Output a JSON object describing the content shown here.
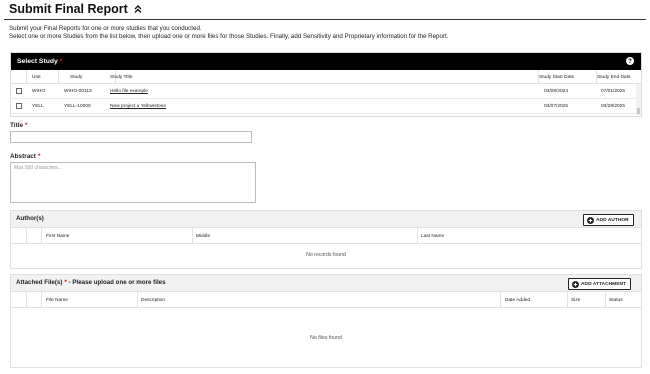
{
  "page": {
    "title": "Submit Final Report",
    "intro_line1": "Submit your Final Reports for one or more studies that you conducted.",
    "intro_line2": "Select one or more Studies from the list below, then upload one or more files for those Studies. Finally, add Sensitivity and Proprietary information for the Report."
  },
  "select_study": {
    "title": "Select Study",
    "required_mark": "*",
    "columns": {
      "unit": "Unit",
      "study": "Study",
      "study_title": "Study Title",
      "start": "Study Start Date",
      "end": "Study End Date"
    },
    "rows": [
      {
        "unit": "WIHO",
        "study": "WIHO-00113",
        "title": "Hello file example",
        "start": "03/08/2024",
        "end": "07/01/2025",
        "checked": false
      },
      {
        "unit": "YELL",
        "study": "YELL-10000",
        "title": "New project a Yellowstone",
        "start": "03/07/2025",
        "end": "03/28/2025",
        "checked": false
      }
    ]
  },
  "title_field": {
    "label": "Title",
    "required_mark": "*",
    "value": ""
  },
  "abstract_field": {
    "label": "Abstract",
    "required_mark": "*",
    "placeholder": "Max 500 characters...",
    "value": ""
  },
  "authors": {
    "title": "Author(s)",
    "add_button": "ADD AUTHOR",
    "columns": {
      "first": "First Name",
      "middle": "Middle",
      "last": "Last Name"
    },
    "empty_text": "No records found"
  },
  "files": {
    "title": "Attached File(s)",
    "required_mark": "*",
    "note": "- Please upload one or more files",
    "add_button": "ADD ATTACHMENT",
    "columns": {
      "file": "File Name",
      "description": "Description",
      "date": "Date Added",
      "size": "Size",
      "status": "Status"
    },
    "empty_text": "No files found"
  }
}
